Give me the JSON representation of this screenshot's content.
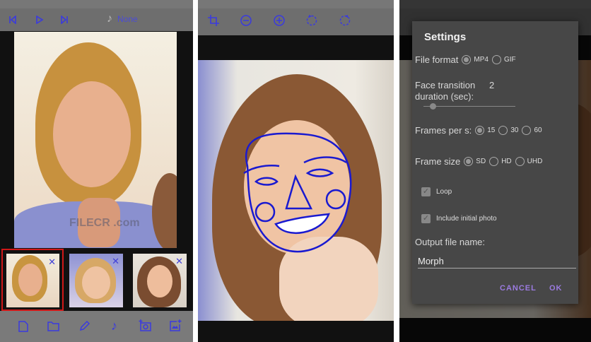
{
  "panel1": {
    "toolbar": {
      "music_label": "None"
    },
    "watermark": "FILECR .com",
    "thumbnails": [
      {
        "close": "✕",
        "selected": true
      },
      {
        "close": "✕",
        "selected": false
      },
      {
        "close": "✕",
        "selected": false
      }
    ],
    "bottom_icons": [
      "new-file-icon",
      "folder-icon",
      "pencil-icon",
      "music-note-icon",
      "add-camera-icon",
      "add-image-icon"
    ],
    "selected_color": "#d01818",
    "icon_color": "#3a3adf"
  },
  "panel2": {
    "toolbar_icons": [
      "crop-icon",
      "zoom-out-icon",
      "zoom-in-icon",
      "rotate-left-icon",
      "rotate-right-icon"
    ],
    "overlay_color": "#1a1ad0"
  },
  "panel3": {
    "dialog": {
      "title": "Settings",
      "file_format_label": "File format",
      "file_format_options": [
        "MP4",
        "GIF"
      ],
      "file_format_selected": "MP4",
      "transition_label_1": "Face transition",
      "transition_label_2": "duration (sec):",
      "transition_value": "2",
      "transition_slider_fraction": 0.1,
      "fps_label": "Frames per s:",
      "fps_options": [
        "15",
        "30",
        "60"
      ],
      "fps_selected": "15",
      "frame_size_label": "Frame size",
      "frame_size_options": [
        "SD",
        "HD",
        "UHD"
      ],
      "frame_size_selected": "SD",
      "loop_label": "Loop",
      "loop_checked": true,
      "include_label": "Include initial photo",
      "include_checked": true,
      "output_label": "Output file name:",
      "output_value": "Morph",
      "cancel": "CANCEL",
      "ok": "OK"
    }
  }
}
